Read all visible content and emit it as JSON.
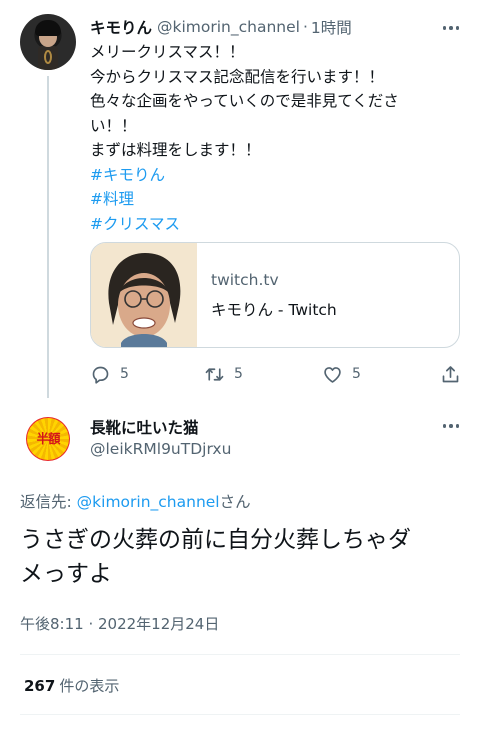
{
  "parent_tweet": {
    "display_name": "キモりん",
    "handle": "@kimorin_channel",
    "separator": "·",
    "time": "1時間",
    "lines": [
      "メリークリスマス！！",
      "今からクリスマス記念配信を行います！！",
      "色々な企画をやっていくので是非見てくださ",
      "い！！",
      "まずは料理をします！！"
    ],
    "hashtags": [
      "#キモりん",
      "#料理",
      "#クリスマス"
    ],
    "card": {
      "domain": "twitch.tv",
      "title": "キモりん - Twitch"
    },
    "actions": {
      "reply_count": "5",
      "retweet_count": "5",
      "like_count": "5"
    }
  },
  "reply_tweet": {
    "display_name": "長靴に吐いた猫",
    "handle": "@leikRMl9uTDjrxu",
    "avatar_text": "半額",
    "replying_prefix": "返信先: ",
    "replying_mention": "@kimorin_channel",
    "replying_suffix": "さん",
    "body_lines": [
      "うさぎの火葬の前に自分火葬しちゃダ",
      "メっすよ"
    ],
    "timestamp": "午後8:11 · 2022年12月24日",
    "views_count": "267",
    "views_label": "件の表示"
  },
  "colors": {
    "link": "#1d9bf0",
    "text": "#0f1419",
    "secondary": "#536471",
    "border": "#cfd9de"
  },
  "icons": [
    "reply-icon",
    "retweet-icon",
    "like-icon",
    "share-icon",
    "more-icon"
  ]
}
